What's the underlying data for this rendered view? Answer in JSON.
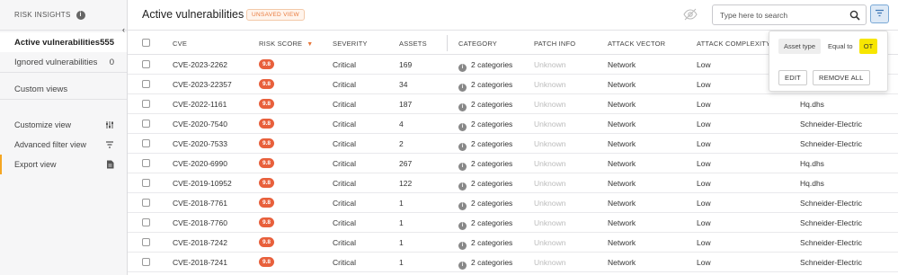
{
  "sidebar": {
    "title": "RISK INSIGHTS",
    "views": [
      {
        "label": "Active vulnerabilities",
        "count": "555"
      },
      {
        "label": "Ignored vulnerabilities",
        "count": "0"
      }
    ],
    "custom_views_label": "Custom views",
    "tools": [
      {
        "label": "Customize view",
        "icon": "sliders-icon"
      },
      {
        "label": "Advanced filter view",
        "icon": "filter-lines-icon"
      },
      {
        "label": "Export view",
        "icon": "document-icon"
      }
    ]
  },
  "header": {
    "title": "Active vulnerabilities",
    "badge": "UNSAVED VIEW",
    "search_placeholder": "Type here to search"
  },
  "table": {
    "columns": [
      "CVE",
      "RISK SCORE",
      "SEVERITY",
      "ASSETS",
      "CATEGORY",
      "PATCH INFO",
      "ATTACK VECTOR",
      "ATTACK COMPLEXITY"
    ],
    "rows": [
      {
        "cve": "CVE-2023-2262",
        "score": "9.8",
        "severity": "Critical",
        "assets": "169",
        "category": "2 categories",
        "patch": "Unknown",
        "vector": "Network",
        "complexity": "Low",
        "vendor": ""
      },
      {
        "cve": "CVE-2023-22357",
        "score": "9.8",
        "severity": "Critical",
        "assets": "34",
        "category": "2 categories",
        "patch": "Unknown",
        "vector": "Network",
        "complexity": "Low",
        "vendor": ""
      },
      {
        "cve": "CVE-2022-1161",
        "score": "9.8",
        "severity": "Critical",
        "assets": "187",
        "category": "2 categories",
        "patch": "Unknown",
        "vector": "Network",
        "complexity": "Low",
        "vendor": "Hq.dhs"
      },
      {
        "cve": "CVE-2020-7540",
        "score": "9.8",
        "severity": "Critical",
        "assets": "4",
        "category": "2 categories",
        "patch": "Unknown",
        "vector": "Network",
        "complexity": "Low",
        "vendor": "Schneider-Electric"
      },
      {
        "cve": "CVE-2020-7533",
        "score": "9.8",
        "severity": "Critical",
        "assets": "2",
        "category": "2 categories",
        "patch": "Unknown",
        "vector": "Network",
        "complexity": "Low",
        "vendor": "Schneider-Electric"
      },
      {
        "cve": "CVE-2020-6990",
        "score": "9.8",
        "severity": "Critical",
        "assets": "267",
        "category": "2 categories",
        "patch": "Unknown",
        "vector": "Network",
        "complexity": "Low",
        "vendor": "Hq.dhs"
      },
      {
        "cve": "CVE-2019-10952",
        "score": "9.8",
        "severity": "Critical",
        "assets": "122",
        "category": "2 categories",
        "patch": "Unknown",
        "vector": "Network",
        "complexity": "Low",
        "vendor": "Hq.dhs"
      },
      {
        "cve": "CVE-2018-7761",
        "score": "9.8",
        "severity": "Critical",
        "assets": "1",
        "category": "2 categories",
        "patch": "Unknown",
        "vector": "Network",
        "complexity": "Low",
        "vendor": "Schneider-Electric"
      },
      {
        "cve": "CVE-2018-7760",
        "score": "9.8",
        "severity": "Critical",
        "assets": "1",
        "category": "2 categories",
        "patch": "Unknown",
        "vector": "Network",
        "complexity": "Low",
        "vendor": "Schneider-Electric"
      },
      {
        "cve": "CVE-2018-7242",
        "score": "9.8",
        "severity": "Critical",
        "assets": "1",
        "category": "2 categories",
        "patch": "Unknown",
        "vector": "Network",
        "complexity": "Low",
        "vendor": "Schneider-Electric"
      },
      {
        "cve": "CVE-2018-7241",
        "score": "9.8",
        "severity": "Critical",
        "assets": "1",
        "category": "2 categories",
        "patch": "Unknown",
        "vector": "Network",
        "complexity": "Low",
        "vendor": "Schneider-Electric"
      }
    ]
  },
  "filter_popover": {
    "field": "Asset type",
    "operator": "Equal to",
    "value": "OT",
    "edit_label": "EDIT",
    "remove_all_label": "REMOVE ALL"
  },
  "colors": {
    "accent": "#e8793c",
    "score_badge": "#e8603c",
    "filter_highlight": "#f7e600"
  }
}
